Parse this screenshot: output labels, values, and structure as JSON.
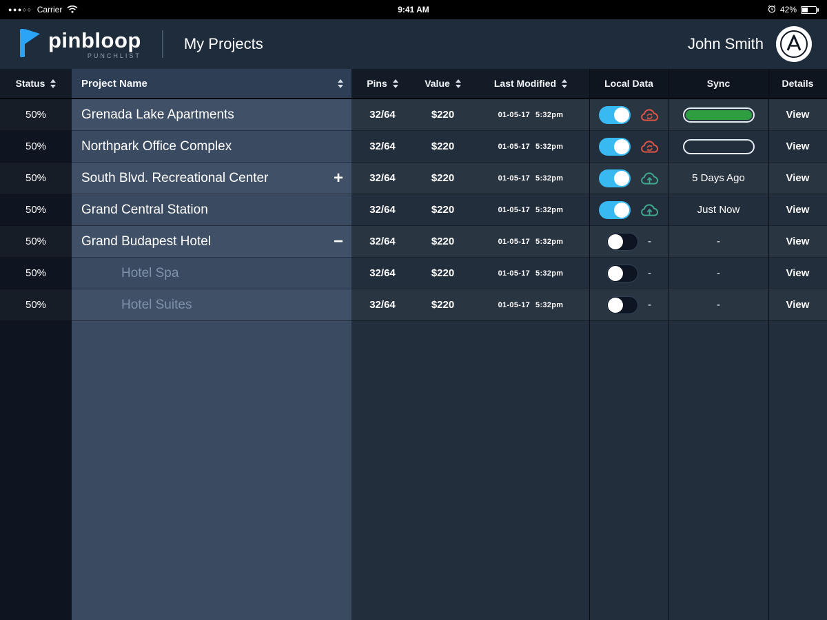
{
  "status_bar": {
    "signal_dots": "●●●○○",
    "carrier": "Carrier",
    "time": "9:41 AM",
    "battery_label": "42%"
  },
  "header": {
    "logo_primary": "pin",
    "logo_secondary": "bloop",
    "tagline": "PUNCHLIST",
    "title": "My Projects",
    "user": "John Smith"
  },
  "colors": {
    "accent_blue": "#2ba3f7",
    "toggle_on": "#38b9f2",
    "sync_green": "#2f9e41",
    "cloud_error_red": "#dd5546",
    "cloud_upload_teal": "#3fa98f"
  },
  "table": {
    "headers": {
      "status": "Status",
      "project": "Project Name",
      "pins": "Pins",
      "value": "Value",
      "modified": "Last Modified",
      "local": "Local Data",
      "sync": "Sync",
      "details": "Details"
    },
    "dash": "-",
    "view_label": "View",
    "rows": [
      {
        "status": "50%",
        "name": "Grenada Lake Apartments",
        "expand": "",
        "child": false,
        "pins": "32/64",
        "value": "$220",
        "date": "01-05-17",
        "time": "5:32pm",
        "toggle": true,
        "cloud": "error",
        "sync": {
          "type": "bar",
          "fill": 100
        }
      },
      {
        "status": "50%",
        "name": "Northpark Office Complex",
        "expand": "",
        "child": false,
        "pins": "32/64",
        "value": "$220",
        "date": "01-05-17",
        "time": "5:32pm",
        "toggle": true,
        "cloud": "error",
        "sync": {
          "type": "bar",
          "fill": 0
        }
      },
      {
        "status": "50%",
        "name": "South Blvd. Recreational Center",
        "expand": "+",
        "child": false,
        "pins": "32/64",
        "value": "$220",
        "date": "01-05-17",
        "time": "5:32pm",
        "toggle": true,
        "cloud": "upload",
        "sync": {
          "type": "text",
          "text": "5 Days Ago"
        }
      },
      {
        "status": "50%",
        "name": "Grand Central Station",
        "expand": "",
        "child": false,
        "pins": "32/64",
        "value": "$220",
        "date": "01-05-17",
        "time": "5:32pm",
        "toggle": true,
        "cloud": "upload",
        "sync": {
          "type": "text",
          "text": "Just Now"
        }
      },
      {
        "status": "50%",
        "name": "Grand Budapest Hotel",
        "expand": "−",
        "child": false,
        "pins": "32/64",
        "value": "$220",
        "date": "01-05-17",
        "time": "5:32pm",
        "toggle": false,
        "cloud": "none",
        "sync": {
          "type": "text",
          "text": "-"
        }
      },
      {
        "status": "50%",
        "name": "Hotel Spa",
        "expand": "",
        "child": true,
        "pins": "32/64",
        "value": "$220",
        "date": "01-05-17",
        "time": "5:32pm",
        "toggle": false,
        "cloud": "none",
        "sync": {
          "type": "text",
          "text": "-"
        }
      },
      {
        "status": "50%",
        "name": "Hotel Suites",
        "expand": "",
        "child": true,
        "pins": "32/64",
        "value": "$220",
        "date": "01-05-17",
        "time": "5:32pm",
        "toggle": false,
        "cloud": "none",
        "sync": {
          "type": "text",
          "text": "-"
        }
      }
    ]
  }
}
